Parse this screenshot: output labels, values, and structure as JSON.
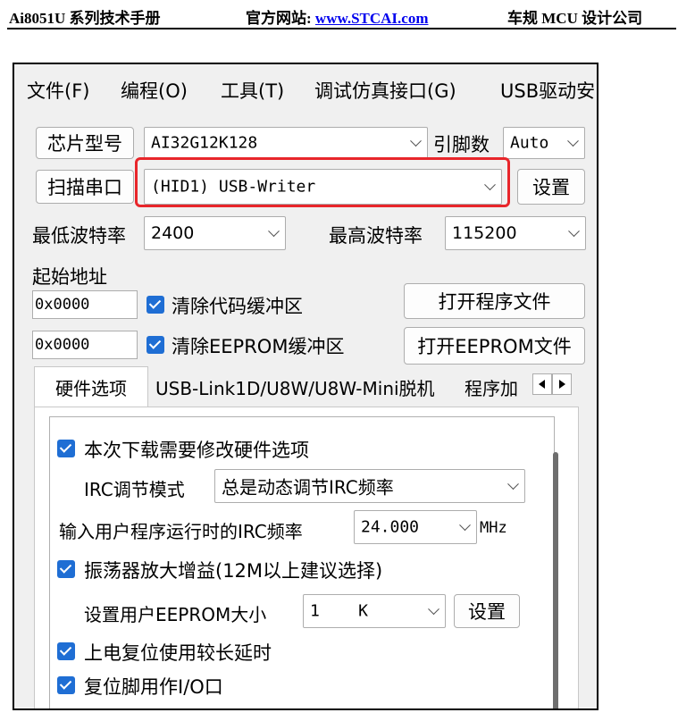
{
  "doc_header": {
    "title": "Ai8051U 系列技术手册",
    "site_label": "官方网站: ",
    "site_url": "www.STCAI.com",
    "company": "车规 MCU 设计公司"
  },
  "menu": {
    "items": [
      "文件(F)",
      "编程(O)",
      "工具(T)",
      "调试仿真接口(G)",
      "USB驱动安"
    ]
  },
  "chip": {
    "button_label": "芯片型号",
    "model_value": "AI32G12K128",
    "pin_label": "引脚数",
    "pin_value": "Auto"
  },
  "port": {
    "scan_button_label": "扫描串口",
    "port_value": "(HID1) USB-Writer",
    "settings_button_label": "设置"
  },
  "baud": {
    "min_label": "最低波特率",
    "min_value": "2400",
    "max_label": "最高波特率",
    "max_value": "115200"
  },
  "address": {
    "start_label": "起始地址",
    "code_addr": "0x0000",
    "clear_code_label": "清除代码缓冲区",
    "open_program_button": "打开程序文件",
    "eeprom_addr": "0x0000",
    "clear_eeprom_label": "清除EEPROM缓冲区",
    "open_eeprom_button": "打开EEPROM文件"
  },
  "tabs": [
    {
      "label": "硬件选项",
      "active": true
    },
    {
      "label": "USB-Link1D/U8W/U8W-Mini脱机"
    },
    {
      "label": "程序加"
    }
  ],
  "hw_options": {
    "modify_hw_label": "本次下载需要修改硬件选项",
    "irc_mode_label": "IRC调节模式",
    "irc_mode_value": "总是动态调节IRC频率",
    "irc_freq_label": "输入用户程序运行时的IRC频率",
    "irc_freq_value": "24.000",
    "irc_freq_unit": "MHz",
    "osc_gain_label": "振荡器放大增益(12M以上建议选择)",
    "eeprom_size_label": "设置用户EEPROM大小",
    "eeprom_size_value": "1    K",
    "eeprom_set_button": "设置",
    "long_reset_label": "上电复位使用较长延时",
    "reset_pin_io_label": "复位脚用作I/O口"
  },
  "colors": {
    "highlight": "#e8262b",
    "checkbox": "#1f6ed4"
  }
}
